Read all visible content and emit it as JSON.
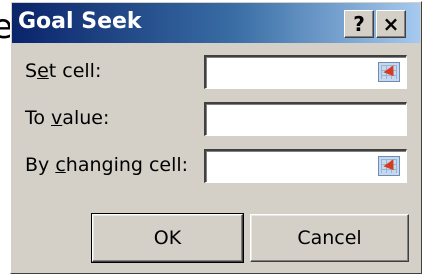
{
  "background_fragment": "e",
  "dialog": {
    "title": "Goal Seek",
    "help_symbol": "?",
    "close_symbol": "×"
  },
  "fields": {
    "set_cell": {
      "label_pre": "S",
      "label_accel": "e",
      "label_post": "t cell:",
      "value": ""
    },
    "to_value": {
      "label_pre": "To ",
      "label_accel": "v",
      "label_post": "alue:",
      "value": ""
    },
    "by_changing_cell": {
      "label_pre": "By ",
      "label_accel": "c",
      "label_post": "hanging cell:",
      "value": ""
    }
  },
  "buttons": {
    "ok_label": "OK",
    "cancel_label": "Cancel"
  },
  "icons": {
    "ref_icon": "collapse-dialog-range-icon"
  }
}
